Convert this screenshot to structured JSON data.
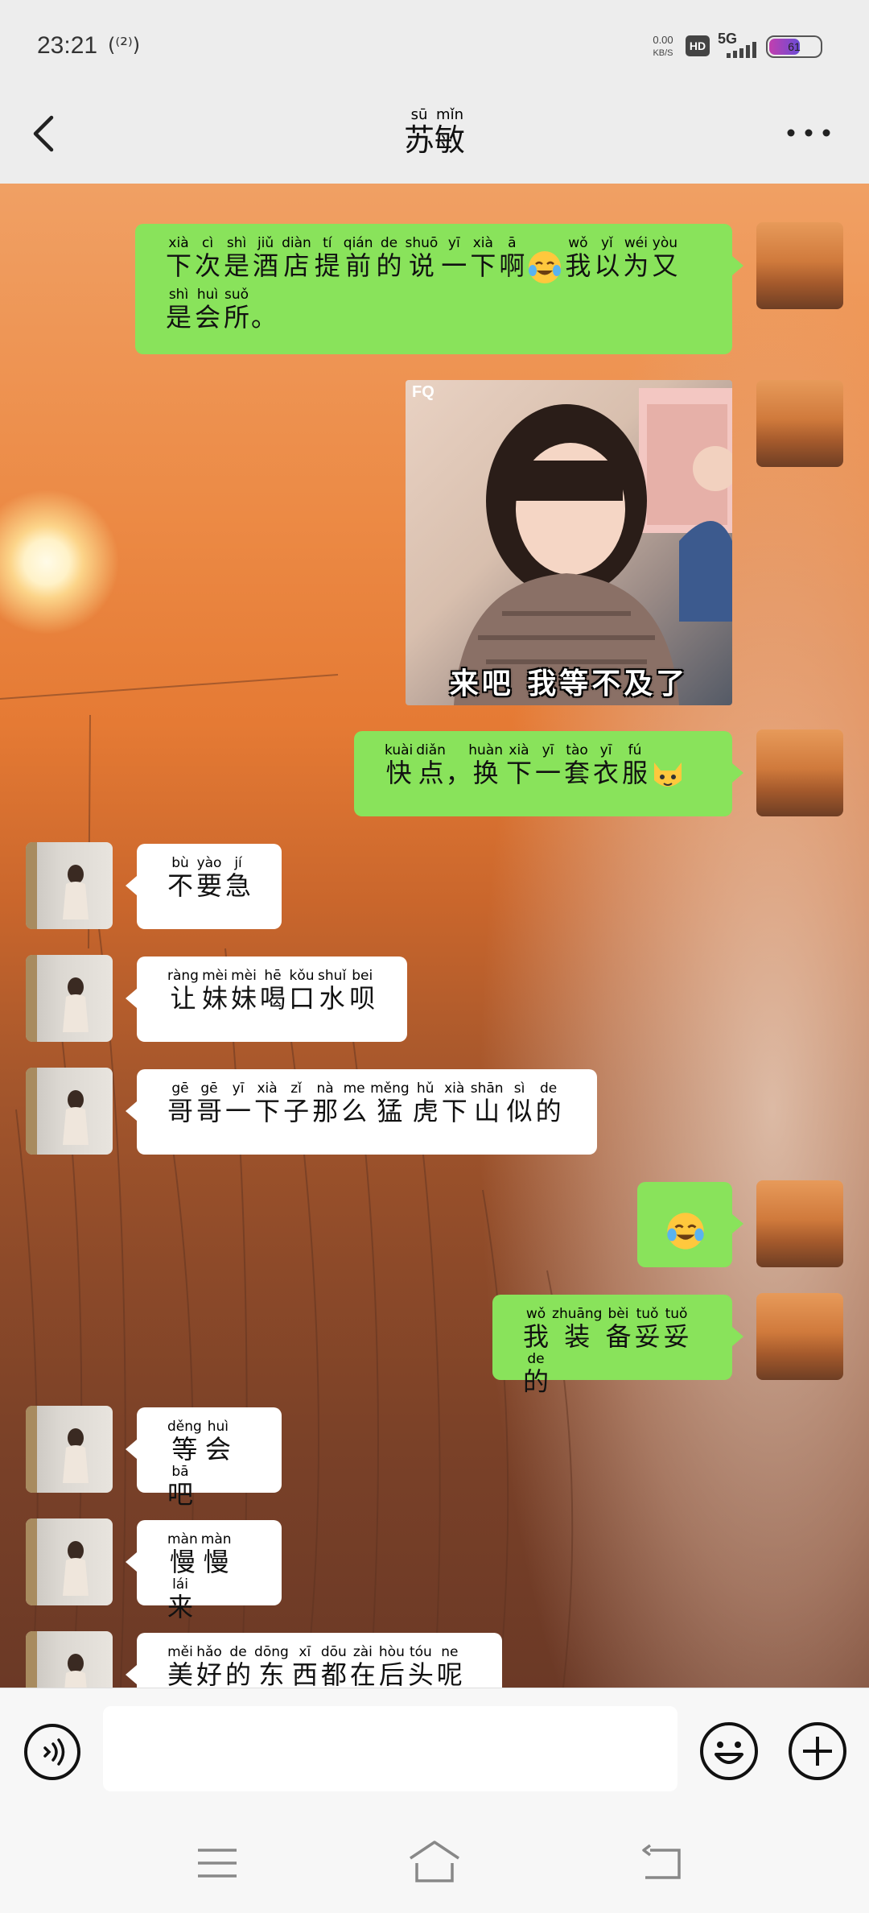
{
  "status_bar": {
    "time": "23:21",
    "hotspot_icon": "hotspot-icon",
    "speed_value": "0.00",
    "speed_unit": "KB/S",
    "hd": "HD",
    "network": "5G",
    "battery_text": "61",
    "battery_level": 0.61
  },
  "header": {
    "back_icon": "chevron-left-icon",
    "title_pinyin": [
      "sū",
      "mǐn"
    ],
    "title_chars": [
      "苏",
      "敏"
    ],
    "more_icon": "more-horizontal-icon"
  },
  "messages": {
    "m1": {
      "sender": "me",
      "line1_pinyin": [
        "xià",
        "cì",
        "shì",
        "jiǔ",
        "diàn",
        "tí",
        "qián",
        "de",
        "shuō",
        "yī",
        "xià",
        "ā"
      ],
      "line1_chars": [
        "下",
        "次",
        "是",
        "酒",
        "店",
        "提",
        "前",
        "的",
        "说",
        "一",
        "下",
        "啊"
      ],
      "emoji": "face-with-tears-of-joy",
      "line1b_pinyin": [
        "wǒ",
        "yǐ",
        "wéi",
        "yòu"
      ],
      "line1b_chars": [
        "我",
        "以",
        "为",
        "又"
      ],
      "line2_pinyin": [
        "shì",
        "huì",
        "suǒ",
        ""
      ],
      "line2_chars": [
        "是",
        "会",
        "所",
        "。"
      ]
    },
    "m2": {
      "sender": "me",
      "type": "sticker",
      "caption": "来吧 我等不及了",
      "logo": "FQ"
    },
    "m3": {
      "sender": "me",
      "pinyin": [
        "kuài",
        "diǎn",
        "",
        "huàn",
        "xià",
        "yī",
        "tào",
        "yī",
        "fú"
      ],
      "chars": [
        "快",
        "点",
        "，",
        "换",
        "下",
        "一",
        "套",
        "衣",
        "服"
      ],
      "emoji": "cat-face"
    },
    "m4": {
      "sender": "other",
      "pinyin": [
        "bù",
        "yào",
        "jí"
      ],
      "chars": [
        "不",
        "要",
        "急"
      ]
    },
    "m5": {
      "sender": "other",
      "pinyin": [
        "ràng",
        "mèi",
        "mèi",
        "hē",
        "kǒu",
        "shuǐ",
        "bei"
      ],
      "chars": [
        "让",
        "妹",
        "妹",
        "喝",
        "口",
        "水",
        "呗"
      ]
    },
    "m6": {
      "sender": "other",
      "pinyin": [
        "gē",
        "gē",
        "yī",
        "xià",
        "zǐ",
        "nà",
        "me",
        "měng",
        "hǔ",
        "xià",
        "shān",
        "sì",
        "de"
      ],
      "chars": [
        "哥",
        "哥",
        "一",
        "下",
        "子",
        "那",
        "么",
        "猛",
        "虎",
        "下",
        "山",
        "似",
        "的"
      ]
    },
    "m7": {
      "sender": "me",
      "emoji": "face-with-tears-of-joy"
    },
    "m8": {
      "sender": "me",
      "pinyin": [
        "wǒ",
        "zhuāng",
        "bèi",
        "tuǒ",
        "tuǒ",
        "de"
      ],
      "chars": [
        "我",
        "装",
        "备",
        "妥",
        "妥",
        "的"
      ]
    },
    "m9": {
      "sender": "other",
      "pinyin": [
        "děng",
        "huì",
        "bā"
      ],
      "chars": [
        "等",
        "会",
        "吧"
      ]
    },
    "m10": {
      "sender": "other",
      "pinyin": [
        "màn",
        "màn",
        "lái"
      ],
      "chars": [
        "慢",
        "慢",
        "来"
      ]
    },
    "m11": {
      "sender": "other",
      "pinyin": [
        "měi",
        "hǎo",
        "de",
        "dōng",
        "xī",
        "dōu",
        "zài",
        "hòu",
        "tóu",
        "ne"
      ],
      "chars": [
        "美",
        "好",
        "的",
        "东",
        "西",
        "都",
        "在",
        "后",
        "头",
        "呢"
      ]
    }
  },
  "input_bar": {
    "voice_icon": "voice-icon",
    "input_value": "",
    "emoji_icon": "smiley-icon",
    "plus_icon": "plus-circle-icon"
  },
  "nav_bar": {
    "menu_icon": "menu-icon",
    "home_icon": "home-icon",
    "back_icon": "back-icon"
  },
  "colors": {
    "sent_bubble": "#89e35b",
    "received_bubble": "#ffffff",
    "header_bg": "#ededed"
  }
}
